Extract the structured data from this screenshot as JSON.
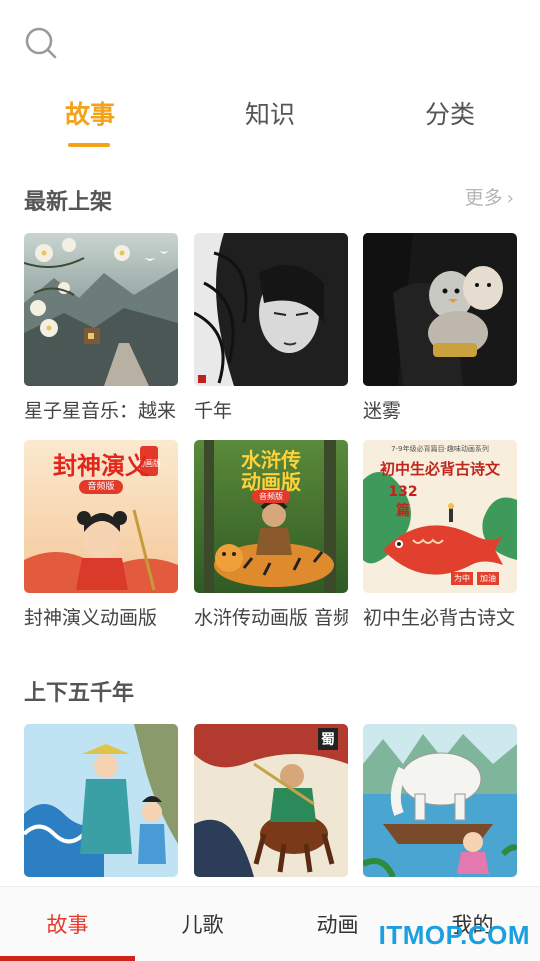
{
  "tabs": {
    "items": [
      "故事",
      "知识",
      "分类"
    ],
    "active": 0
  },
  "section1": {
    "title": "最新上架",
    "more": "更多",
    "cards": [
      {
        "title": "星子星音乐：越来"
      },
      {
        "title": "千年"
      },
      {
        "title": "迷雾"
      },
      {
        "title": "封神演义动画版",
        "cover_text": "封神演义",
        "cover_sub": "音频版",
        "cover_badge": "动画版"
      },
      {
        "title": "水浒传动画版 音频",
        "cover_text": "水浒传",
        "cover_text2": "动画版",
        "cover_sub": "音频版"
      },
      {
        "title": "初中生必背古诗文",
        "cover_top": "7-9年级必背篇目·趣味动画系列",
        "cover_text": "初中生必背古诗文",
        "cover_sub": "132篇",
        "cover_tag": "为中",
        "cover_tag2": "加油"
      }
    ]
  },
  "section2": {
    "title": "上下五千年",
    "cards": [
      {
        "title": ""
      },
      {
        "title": "",
        "cover_mark": "蜀"
      },
      {
        "title": ""
      }
    ]
  },
  "bottom_nav": {
    "items": [
      "故事",
      "儿歌",
      "动画",
      "我的"
    ],
    "active": 0
  },
  "watermark": "ITMOP.COM",
  "colors": {
    "accent": "#f2a31a",
    "nav_active": "#e53a2c",
    "nav_indicator": "#d0241b",
    "muted": "#b5b5b5"
  }
}
